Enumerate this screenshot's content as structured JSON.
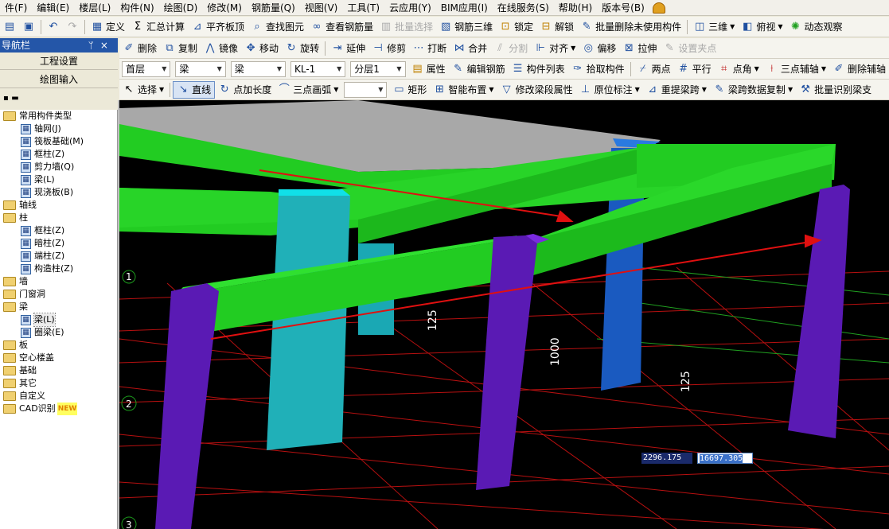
{
  "menubar": {
    "items": [
      "件(F)",
      "编辑(E)",
      "楼层(L)",
      "构件(N)",
      "绘图(D)",
      "修改(M)",
      "钢筋量(Q)",
      "视图(V)",
      "工具(T)",
      "云应用(Y)",
      "BIM应用(I)",
      "在线服务(S)",
      "帮助(H)",
      "版本号(B)"
    ]
  },
  "toolbar1": {
    "define": "定义",
    "sum": "汇总计算",
    "align_slab": "平齐板顶",
    "find": "查找图元",
    "view_rebar": "查看钢筋量",
    "batch_select": "批量选择",
    "rebar_3d": "钢筋三维",
    "lock": "锁定",
    "unlock": "解锁",
    "batch_delete": "批量删除未使用构件",
    "view_mode": "三维",
    "top_view": "俯视",
    "dynamic": "动态观察"
  },
  "toolbar2": {
    "delete": "删除",
    "copy": "复制",
    "mirror": "镜像",
    "move": "移动",
    "rotate": "旋转",
    "extend": "延伸",
    "trim": "修剪",
    "break": "打断",
    "merge": "合并",
    "split": "分割",
    "align": "对齐",
    "offset": "偏移",
    "stretch": "拉伸",
    "set_point": "设置夹点"
  },
  "toolbar3": {
    "floor": "首层",
    "type": "梁",
    "subtype": "梁",
    "component": "KL-1",
    "layer": "分层1",
    "props": "属性",
    "edit_rebar": "编辑钢筋",
    "comp_list": "构件列表",
    "pick": "拾取构件",
    "two_point": "两点",
    "parallel": "平行",
    "point_angle": "点角",
    "three_point_axis": "三点辅轴",
    "delete_axis": "删除辅轴"
  },
  "toolbar4": {
    "select": "选择",
    "line": "直线",
    "point_len": "点加长度",
    "three_arc": "三点画弧",
    "rect": "矩形",
    "smart": "智能布置",
    "modify_beam": "修改梁段属性",
    "orig_mark": "原位标注",
    "re_span": "重提梁跨",
    "span_copy": "梁跨数据复制",
    "batch_identify": "批量识别梁支"
  },
  "nav": {
    "title": "导航栏",
    "project_settings": "工程设置",
    "drawing_input": "绘图输入",
    "tree": [
      {
        "label": "常用构件类型",
        "level": 0,
        "kind": "folder"
      },
      {
        "label": "轴网(J)",
        "level": 1,
        "kind": "item"
      },
      {
        "label": "筏板基础(M)",
        "level": 1,
        "kind": "item"
      },
      {
        "label": "框柱(Z)",
        "level": 1,
        "kind": "item"
      },
      {
        "label": "剪力墙(Q)",
        "level": 1,
        "kind": "item"
      },
      {
        "label": "梁(L)",
        "level": 1,
        "kind": "item"
      },
      {
        "label": "现浇板(B)",
        "level": 1,
        "kind": "item"
      },
      {
        "label": "轴线",
        "level": 0,
        "kind": "folder"
      },
      {
        "label": "柱",
        "level": 0,
        "kind": "folder"
      },
      {
        "label": "框柱(Z)",
        "level": 1,
        "kind": "item"
      },
      {
        "label": "暗柱(Z)",
        "level": 1,
        "kind": "item"
      },
      {
        "label": "端柱(Z)",
        "level": 1,
        "kind": "item"
      },
      {
        "label": "构造柱(Z)",
        "level": 1,
        "kind": "item"
      },
      {
        "label": "墙",
        "level": 0,
        "kind": "folder"
      },
      {
        "label": "门窗洞",
        "level": 0,
        "kind": "folder"
      },
      {
        "label": "梁",
        "level": 0,
        "kind": "folder"
      },
      {
        "label": "梁(L)",
        "level": 1,
        "kind": "item",
        "selected": true
      },
      {
        "label": "圈梁(E)",
        "level": 1,
        "kind": "item"
      },
      {
        "label": "板",
        "level": 0,
        "kind": "folder"
      },
      {
        "label": "空心楼盖",
        "level": 0,
        "kind": "folder"
      },
      {
        "label": "基础",
        "level": 0,
        "kind": "folder"
      },
      {
        "label": "其它",
        "level": 0,
        "kind": "folder"
      },
      {
        "label": "自定义",
        "level": 0,
        "kind": "folder"
      },
      {
        "label": "CAD识别",
        "level": 0,
        "kind": "folder",
        "badge": "NEW"
      }
    ]
  },
  "viewport": {
    "dims": [
      "125",
      "1000",
      "125"
    ],
    "axis_labels": [
      "1",
      "2",
      "3"
    ],
    "coord_x": "2296.175",
    "coord_y": "16697.305",
    "colors": {
      "beam": "#22cc22",
      "column_purple": "#5a1ab4",
      "column_cyan": "#20b0b8",
      "column_blue": "#1a5ac0",
      "slab": "#a8a8a8",
      "arrow": "#e01010",
      "grid": "#c01010"
    }
  }
}
